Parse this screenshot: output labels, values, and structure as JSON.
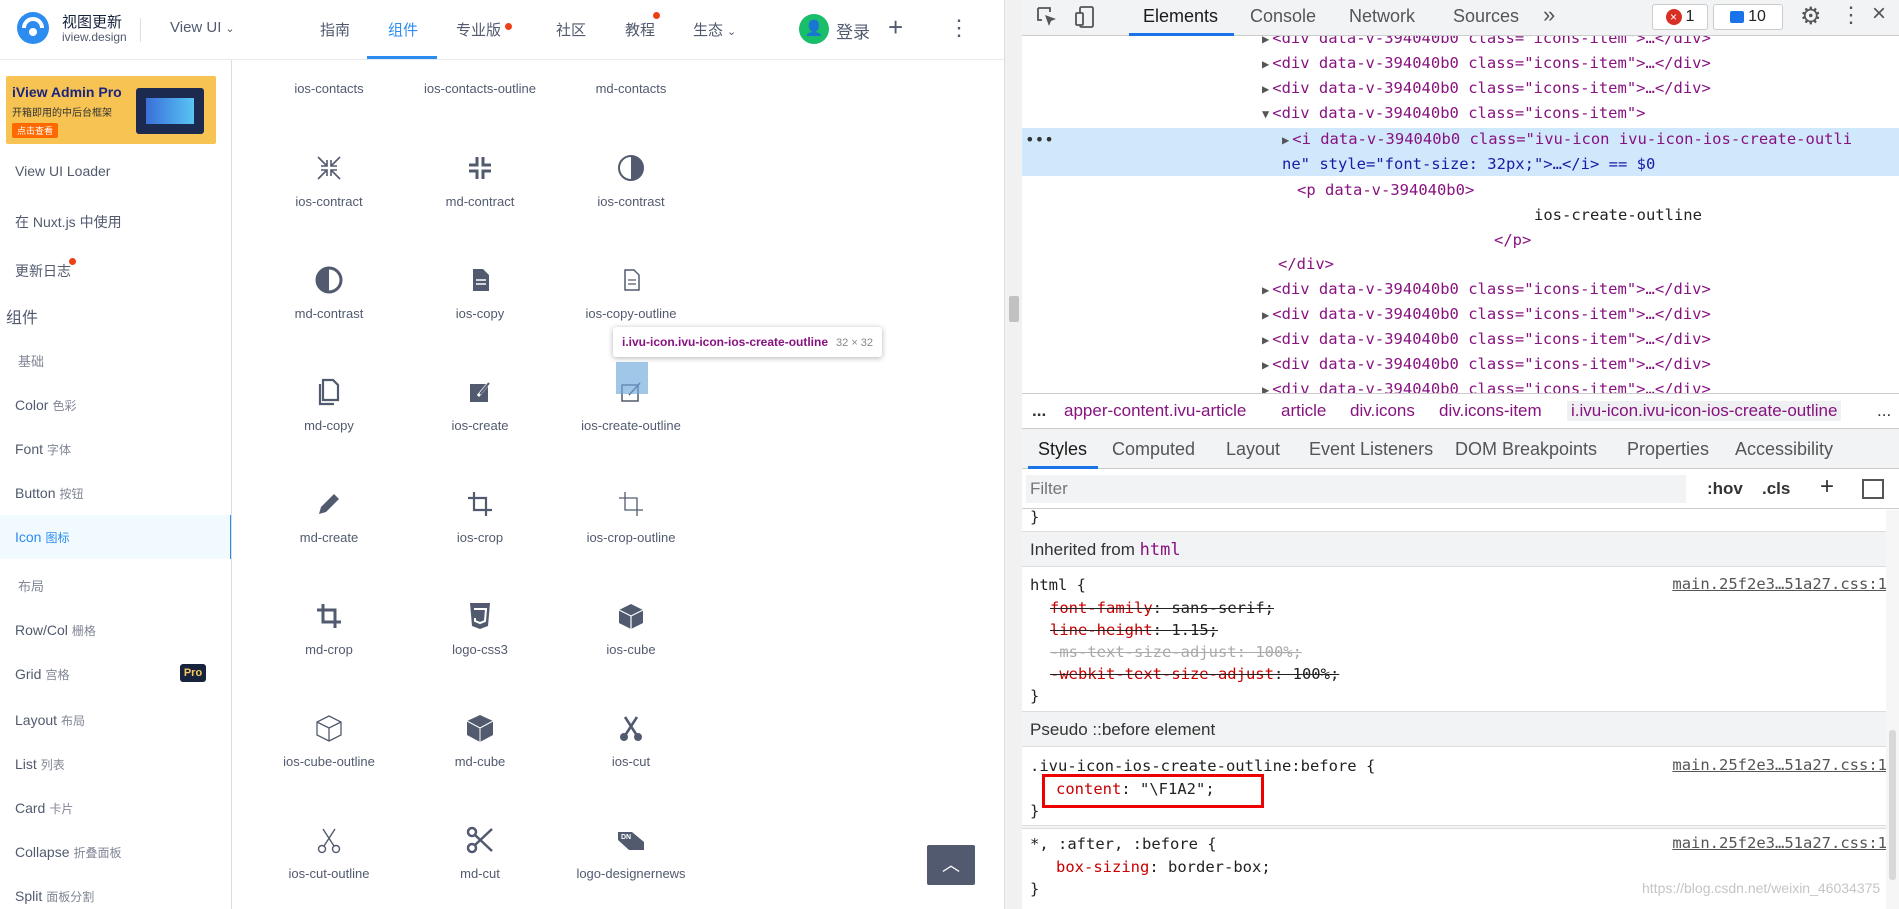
{
  "site": {
    "logo": {
      "title": "视图更新",
      "subtitle": "iview.design"
    },
    "version_label": "View UI",
    "nav": [
      {
        "label": "指南"
      },
      {
        "label": "组件"
      },
      {
        "label": "专业版"
      },
      {
        "label": "社区"
      },
      {
        "label": "教程"
      },
      {
        "label": "生态"
      }
    ],
    "login_label": "登录",
    "colors": {
      "accent": "#2d8cf0",
      "text": "#515a6e",
      "avatar": "#19be6b",
      "badge_dot": "#ed4014"
    },
    "banner": {
      "title": "iView Admin Pro",
      "subtitle": "开箱即用的中后台框架",
      "button": "点击查看"
    },
    "sidebar": {
      "items": [
        {
          "label": "View UI Loader",
          "sub": ""
        },
        {
          "label": "在 Nuxt.js 中使用",
          "sub": ""
        },
        {
          "label": "更新日志",
          "sub": ""
        }
      ],
      "group_label": "组件",
      "sub_basic": "基础",
      "basic_items": [
        {
          "label": "Color",
          "sub": "色彩"
        },
        {
          "label": "Font",
          "sub": "字体"
        },
        {
          "label": "Button",
          "sub": "按钮"
        },
        {
          "label": "Icon",
          "sub": "图标"
        }
      ],
      "sub_layout": "布局",
      "layout_items": [
        {
          "label": "Row/Col",
          "sub": "栅格"
        },
        {
          "label": "Grid",
          "sub": "宫格"
        },
        {
          "label": "Layout",
          "sub": "布局"
        },
        {
          "label": "List",
          "sub": "列表"
        },
        {
          "label": "Card",
          "sub": "卡片"
        },
        {
          "label": "Collapse",
          "sub": "折叠面板"
        },
        {
          "label": "Split",
          "sub": "面板分割"
        }
      ],
      "pro_badge": "Pro",
      "active_item": "Icon"
    },
    "icons": [
      [
        "ios-contacts",
        "ios-contacts-outline",
        "md-contacts"
      ],
      [
        "ios-contract",
        "md-contract",
        "ios-contrast"
      ],
      [
        "md-contrast",
        "ios-copy",
        "ios-copy-outline"
      ],
      [
        "md-copy",
        "ios-create",
        "ios-create-outline"
      ],
      [
        "md-create",
        "ios-crop",
        "ios-crop-outline"
      ],
      [
        "md-crop",
        "logo-css3",
        "ios-cube"
      ],
      [
        "ios-cube-outline",
        "md-cube",
        "ios-cut"
      ],
      [
        "ios-cut-outline",
        "md-cut",
        "logo-designernews"
      ]
    ],
    "tooltip": {
      "selector": "i.ivu-icon.ivu-icon-ios-create-outline",
      "size": "32 × 32"
    }
  },
  "devtools": {
    "tabs": [
      "Elements",
      "Console",
      "Network",
      "Sources"
    ],
    "active_tab": "Elements",
    "more_tabs": "»",
    "errors": "1",
    "messages": "10",
    "dom": {
      "collapsed_line": "<div data-v-394040b0 class=\"icons-item\">…</div>",
      "open_div": "<div data-v-394040b0 class=\"icons-item\">",
      "selected_i_1": "<i data-v-394040b0 class=\"ivu-icon ivu-icon-ios-create-outli",
      "selected_i_2": "ne\" style=\"font-size: 32px;\">…</i> == $0",
      "p_open": "<p data-v-394040b0>",
      "p_text": "ios-create-outline",
      "p_close": "</p>",
      "div_close": "</div>"
    },
    "breadcrumb": [
      "...",
      "apper-content.ivu-article",
      "article",
      "div.icons",
      "div.icons-item",
      "i.ivu-icon.ivu-icon-ios-create-outline",
      "..."
    ],
    "subtabs": [
      "Styles",
      "Computed",
      "Layout",
      "Event Listeners",
      "DOM Breakpoints",
      "Properties",
      "Accessibility"
    ],
    "active_subtab": "Styles",
    "filter_placeholder": "Filter",
    "hov": ":hov",
    "cls": ".cls",
    "styles": {
      "inherited_label": "Inherited from",
      "inherited_tag": "html",
      "html_rule": {
        "selector": "html {",
        "source": "main.25f2e3…51a27.css:1",
        "props": [
          {
            "name": "font-family",
            "value": "sans-serif;"
          },
          {
            "name": "line-height",
            "value": "1.15;"
          },
          {
            "name": "-ms-text-size-adjust",
            "value": "100%;"
          },
          {
            "name": "-webkit-text-size-adjust",
            "value": "100%;"
          }
        ]
      },
      "pseudo_label": "Pseudo ::before element",
      "pseudo_rule": {
        "selector": ".ivu-icon-ios-create-outline:before {",
        "source": "main.25f2e3…51a27.css:1",
        "prop": "content",
        "value": "\"\\F1A2\";"
      },
      "universal_rule": {
        "selector": "*, :after, :before {",
        "source": "main.25f2e3…51a27.css:1",
        "prop": "box-sizing",
        "value": "border-box;"
      },
      "close": "}"
    },
    "watermark": "https://blog.csdn.net/weixin_46034375"
  }
}
